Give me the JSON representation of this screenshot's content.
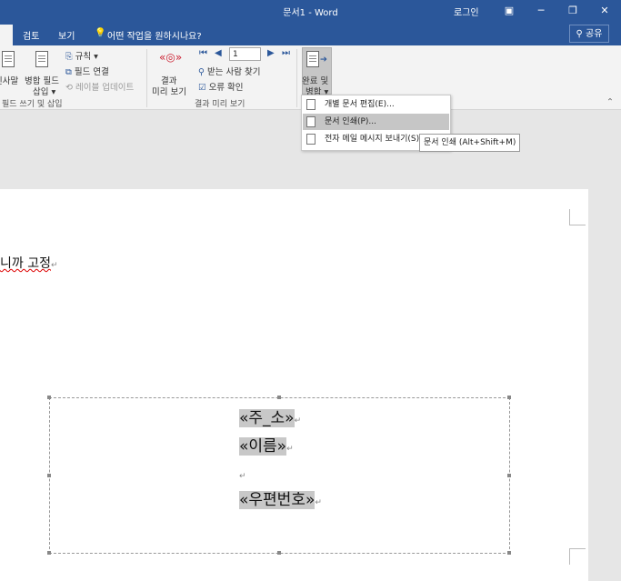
{
  "titlebar": {
    "title": "문서1 - Word",
    "login": "로그인",
    "window_buttons": [
      "▣",
      "─",
      "❐",
      "✕"
    ]
  },
  "tabs": {
    "review": "검토",
    "view": "보기",
    "tell_me": "어떤 작업을 원하시나요?",
    "share": "공유"
  },
  "ribbon": {
    "greeting_line": "인사말",
    "insert_merge_field_1": "병합 필드",
    "insert_merge_field_2": "삽입",
    "rules": "규칙",
    "match_fields": "필드 연결",
    "update_labels": "레이블 업데이트",
    "write_insert_group": "필드 쓰기 및 삽입",
    "preview_1": "결과",
    "preview_2": "미리 보기",
    "record_number": "1",
    "find_recipient": "받는 사람 찾기",
    "check_errors": "오류 확인",
    "preview_group": "결과 미리 보기",
    "finish_1": "완료 및",
    "finish_2": "병합"
  },
  "menu": {
    "edit_individual": "개별 문서 편집(E)...",
    "print_documents": "문서 인쇄(P)...",
    "send_email": "전자 메일 메시지 보내기(S)..."
  },
  "tooltip": "문서 인쇄 (Alt+Shift+M)",
  "document": {
    "line1": "니까 고정",
    "field_address": "«주_소»",
    "field_name": "«이름»",
    "field_zip": "«우편번호»",
    "para_mark": "↵"
  }
}
